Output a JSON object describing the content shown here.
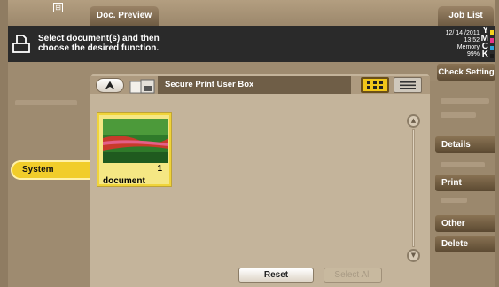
{
  "header": {
    "icon": "grid-icon",
    "tab_preview": "Doc. Preview",
    "tab_joblist": "Job List"
  },
  "message": {
    "text": "Select document(s) and then\nchoose the desired function."
  },
  "status": {
    "date": "12/ 14 /2011",
    "time": "13:52",
    "memory_label": "Memory",
    "memory_pct": "99%",
    "toner": [
      {
        "letter": "Y",
        "color": "#f4d21e"
      },
      {
        "letter": "M",
        "color": "#e8358c"
      },
      {
        "letter": "C",
        "color": "#2ea3dc"
      },
      {
        "letter": "K",
        "color": "#1a1a1a"
      }
    ]
  },
  "right": {
    "check_setting": "Check Setting",
    "details": "Details",
    "print": "Print",
    "other": "Other",
    "delete": "Delete"
  },
  "left": {
    "system": "System"
  },
  "box": {
    "title": "Secure Print User Box",
    "up_icon": "up-arrow-icon",
    "view_grid_icon": "grid-view-icon",
    "view_list_icon": "list-view-icon"
  },
  "document": {
    "count": "1",
    "name": "document"
  },
  "footer": {
    "reset": "Reset",
    "select_all": "Select All"
  }
}
